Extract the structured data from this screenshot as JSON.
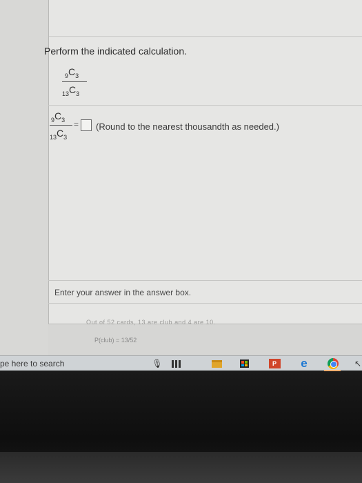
{
  "question": {
    "prompt": "Perform the indicated calculation.",
    "numerator": {
      "n": "9",
      "r": "3",
      "symbol": "C"
    },
    "denominator": {
      "n": "13",
      "r": "3",
      "symbol": "C"
    },
    "equals": "=",
    "answer_value": "",
    "round_note": "(Round to the nearest thousandth as needed.)"
  },
  "instruction": "Enter your answer in the answer box.",
  "partial_strip": "Out of 52 cards, 13 are club and 4 are 10.",
  "pclub": "P(club) = 13/52",
  "taskbar": {
    "search_text": "pe here to search",
    "ppt_label": "P",
    "icons": [
      "microphone-icon",
      "task-view-icon",
      "file-explorer-icon",
      "store-icon",
      "powerpoint-icon",
      "edge-icon",
      "chrome-icon",
      "arrow-icon"
    ]
  },
  "colors": {
    "panel": "#e6e6e4",
    "taskbar": "#cfd3d6",
    "edge_blue": "#1976d2",
    "ppt_red": "#d0452a"
  }
}
